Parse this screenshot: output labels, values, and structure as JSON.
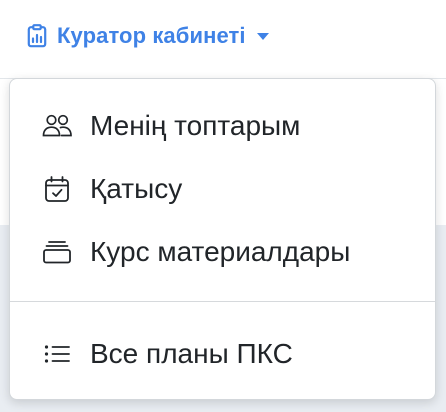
{
  "nav": {
    "title": "Куратор кабинеті",
    "icon": "clipboard-chart-icon",
    "caret_icon": "caret-down-icon",
    "accent_color": "#3f82e6"
  },
  "dropdown": {
    "items": [
      {
        "label": "Менің топтарым",
        "icon": "people-icon"
      },
      {
        "label": "Қатысу",
        "icon": "calendar-check-icon"
      },
      {
        "label": "Курс материалдары",
        "icon": "collection-icon"
      }
    ],
    "secondary_items": [
      {
        "label": "Все планы ПКС",
        "icon": "list-icon"
      }
    ]
  }
}
